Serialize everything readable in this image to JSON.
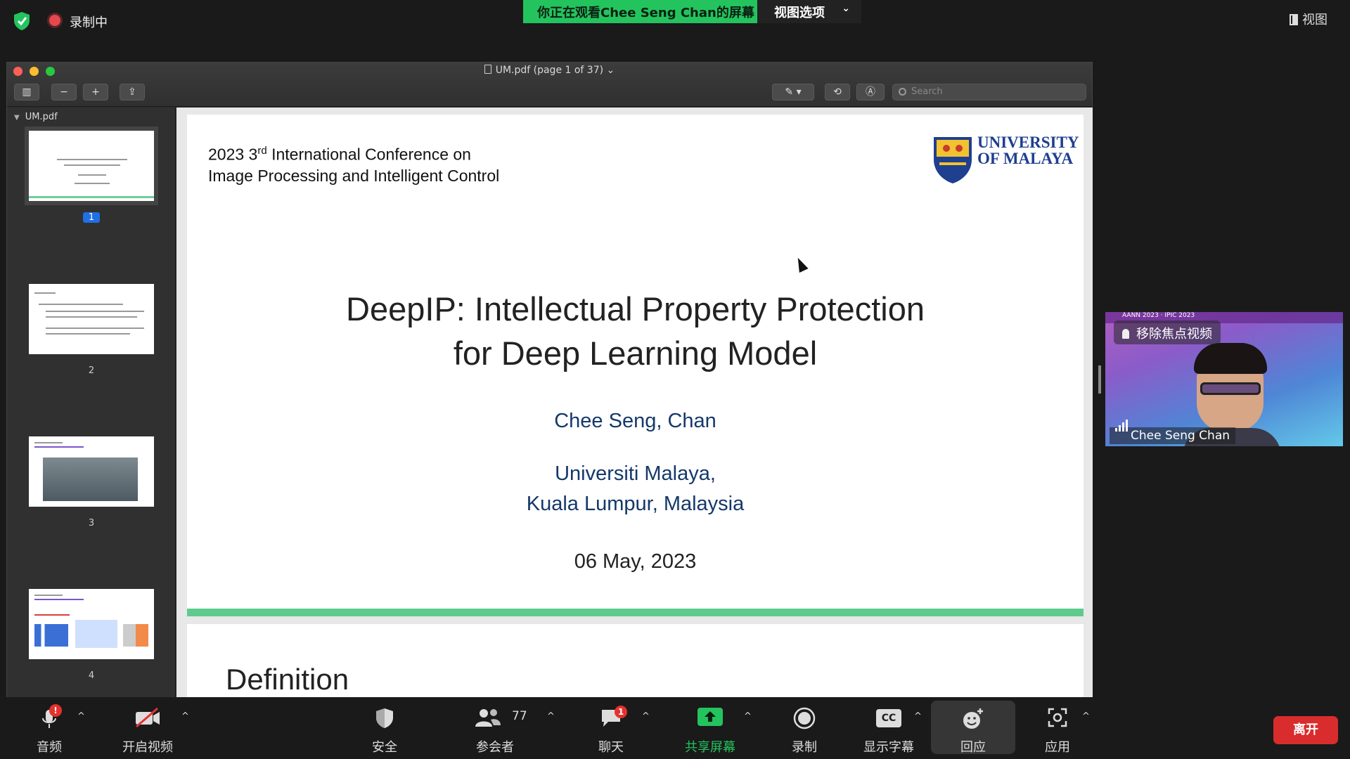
{
  "topbar": {
    "recording_label": "录制中",
    "share_banner": "你正在观看Chee Seng Chan的屏幕",
    "view_options_label": "视图选项",
    "view_label": "视图"
  },
  "preview": {
    "doc_title": "UM.pdf (page 1 of 37)",
    "search_placeholder": "Search",
    "sidebar_title": "UM.pdf",
    "thumbnails": [
      {
        "num": "1",
        "selected": true
      },
      {
        "num": "2",
        "selected": false
      },
      {
        "num": "3",
        "selected": false
      },
      {
        "num": "4",
        "selected": false
      }
    ]
  },
  "slide": {
    "conf_line1_pre": "2023 3",
    "conf_line1_sup": "rd",
    "conf_line1_post": " International Conference on",
    "conf_line2": "Image Processing and Intelligent Control",
    "logo_line1": "UNIVERSITY",
    "logo_line2": "OF MALAYA",
    "title_line1": "DeepIP: Intellectual Property Protection",
    "title_line2": "for Deep Learning Model",
    "author": "Chee Seng, Chan",
    "affil_line1": "Universiti Malaya,",
    "affil_line2": "Kuala Lumpur, Malaysia",
    "date": "06 May, 2023",
    "next_page_title": "Definition"
  },
  "video": {
    "banner": "AANN 2023 · IPIC 2023",
    "unpin_label": "移除焦点视频",
    "name": "Chee Seng Chan"
  },
  "toolbar": {
    "audio": "音频",
    "video": "开启视频",
    "security": "安全",
    "participants": "参会者",
    "participants_count": "77",
    "chat": "聊天",
    "chat_badge": "1",
    "share": "共享屏幕",
    "record": "录制",
    "captions": "显示字幕",
    "captions_icon_text": "CC",
    "reactions": "回应",
    "apps": "应用",
    "leave": "离开"
  },
  "colors": {
    "share_green": "#23c45e",
    "leave_red": "#d92c2c",
    "um_blue": "#1f3f8f",
    "slide_bar": "#5ecb8e"
  }
}
